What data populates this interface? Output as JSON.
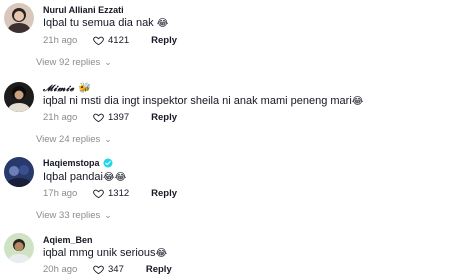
{
  "comments": [
    {
      "username": "Nurul Alliani Ezzati",
      "text": "Iqbal tu semua dia nak",
      "emoji": "😂",
      "time": "21h ago",
      "likes": "4121",
      "reply_label": "Reply",
      "view_replies": "View 92 replies"
    },
    {
      "username": "𝓜𝓲𝓶𝓲𝓮",
      "username_emoji": "🐝",
      "text": "iqbal ni msti dia ingt inspektor sheila ni anak mami peneng mari",
      "emoji": "😂",
      "time": "21h ago",
      "likes": "1397",
      "reply_label": "Reply",
      "view_replies": "View 24 replies"
    },
    {
      "username": "Haqiemstopa",
      "verified": true,
      "text": "Iqbal pandai",
      "emoji": "😂😂",
      "time": "17h ago",
      "likes": "1312",
      "reply_label": "Reply",
      "view_replies": "View 33 replies"
    },
    {
      "username": "Aqiem_Ben",
      "text": "iqbal mmg unik serious",
      "emoji": "😂",
      "time": "20h ago",
      "likes": "347",
      "reply_label": "Reply"
    }
  ],
  "colors": {
    "text_primary": "#161823",
    "text_secondary": "#8a8b91",
    "verified_badge": "#20d5ec"
  },
  "icons": {
    "like": "heart-outline-icon",
    "expand": "chevron-down-icon",
    "verified": "verified-check-icon"
  }
}
